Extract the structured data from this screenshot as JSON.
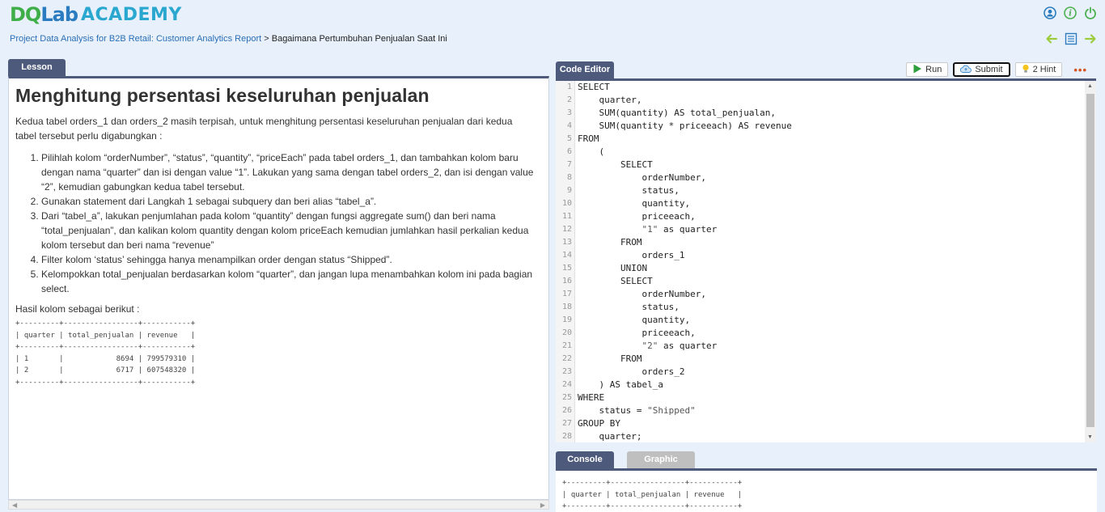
{
  "header": {
    "logo_part1": "DQ",
    "logo_part2": "Lab",
    "logo_part3": "ACADEMY",
    "icons": [
      "user-icon",
      "info-icon",
      "power-icon"
    ]
  },
  "breadcrumb": {
    "parent": "Project Data Analysis for B2B Retail: Customer Analytics Report",
    "separator": " > ",
    "current": "Bagaimana Pertumbuhan Penjualan Saat Ini"
  },
  "nav_icons": [
    "arrow-left-icon",
    "list-icon",
    "arrow-right-icon"
  ],
  "lesson": {
    "tab_label": "Lesson",
    "title": "Menghitung persentasi keseluruhan penjualan",
    "intro": "Kedua tabel orders_1 dan orders_2 masih terpisah, untuk menghitung persentasi keseluruhan penjualan dari kedua tabel tersebut perlu digabungkan :",
    "steps": [
      "Pilihlah kolom “orderNumber”, “status”, “quantity”, “priceEach” pada tabel orders_1, dan tambahkan kolom baru dengan nama “quarter” dan isi dengan value “1”. Lakukan yang sama dengan tabel orders_2, dan isi dengan value “2”, kemudian gabungkan kedua tabel tersebut.",
      "Gunakan statement dari Langkah 1 sebagai subquery dan beri alias “tabel_a”.",
      "Dari “tabel_a”, lakukan penjumlahan pada kolom “quantity” dengan fungsi aggregate sum() dan beri nama “total_penjualan”, dan kalikan kolom quantity dengan kolom priceEach kemudian jumlahkan hasil perkalian kedua kolom tersebut dan beri nama “revenue”",
      "Filter kolom ‘status’ sehingga hanya menampilkan order dengan status “Shipped”.",
      "Kelompokkan total_penjualan berdasarkan kolom “quarter”, dan jangan lupa menambahkan kolom ini pada bagian select."
    ],
    "result_label": "Hasil kolom sebagai berikut :",
    "result_table": "+---------+-----------------+-----------+\n| quarter | total_penjualan | revenue   |\n+---------+-----------------+-----------+\n| 1       |            8694 | 799579310 |\n| 2       |            6717 | 607548320 |\n+---------+-----------------+-----------+"
  },
  "editor": {
    "tab_label": "Code Editor",
    "run_label": "Run",
    "submit_label": "Submit",
    "hint_label": "2 Hint",
    "lines": [
      "SELECT",
      "    quarter,",
      "    SUM(quantity) AS total_penjualan,",
      "    SUM(quantity * priceeach) AS revenue",
      "FROM",
      "    (",
      "        SELECT",
      "            orderNumber,",
      "            status,",
      "            quantity,",
      "            priceeach,",
      "            \"1\" as quarter",
      "        FROM",
      "            orders_1",
      "        UNION",
      "        SELECT",
      "            orderNumber,",
      "            status,",
      "            quantity,",
      "            priceeach,",
      "            \"2\" as quarter",
      "        FROM",
      "            orders_2",
      "    ) AS tabel_a",
      "WHERE",
      "    status = \"Shipped\"",
      "GROUP BY",
      "    quarter;"
    ]
  },
  "console": {
    "tab_label": "Console",
    "graphic_tab_label": "Graphic",
    "output": "+---------+-----------------+-----------+\n| quarter | total_penjualan | revenue   |\n+---------+-----------------+-----------+"
  }
}
